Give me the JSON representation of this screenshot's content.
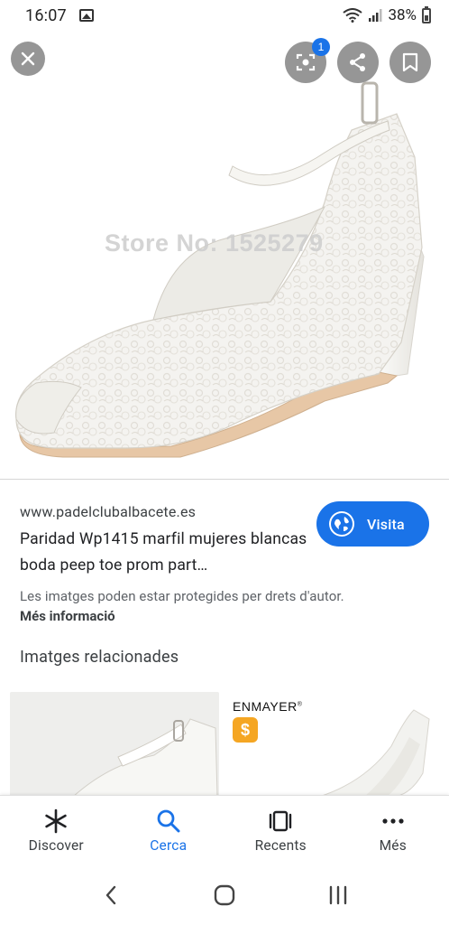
{
  "status_bar": {
    "time": "16:07",
    "battery": "38%"
  },
  "image_viewer": {
    "watermark": "Store No: 1525279",
    "lens_badge": "1",
    "close_icon": "close-icon",
    "lens_icon": "lens-icon",
    "share_icon": "share-icon",
    "save_icon": "bookmark-icon"
  },
  "result": {
    "site": "www.padelclubalbacete.es",
    "title": "Paridad Wp1415 marfil mujeres blancas boda peep toe prom part…",
    "visit_label": "Visita",
    "copyright": "Les imatges poden estar protegides per drets d'autor.",
    "more_info": "Més informació"
  },
  "related": {
    "heading": "Imatges relacionades",
    "items": [
      {
        "brand": ""
      },
      {
        "brand": "ENMAYER"
      }
    ]
  },
  "bottom_nav": [
    {
      "label": "Discover",
      "icon": "asterisk-icon",
      "active": false
    },
    {
      "label": "Cerca",
      "icon": "search-icon",
      "active": true
    },
    {
      "label": "Recents",
      "icon": "recents-icon",
      "active": false
    },
    {
      "label": "Més",
      "icon": "more-icon",
      "active": false
    }
  ],
  "colors": {
    "accent": "#1a73e8",
    "text": "#202124",
    "muted": "#5f6368"
  }
}
